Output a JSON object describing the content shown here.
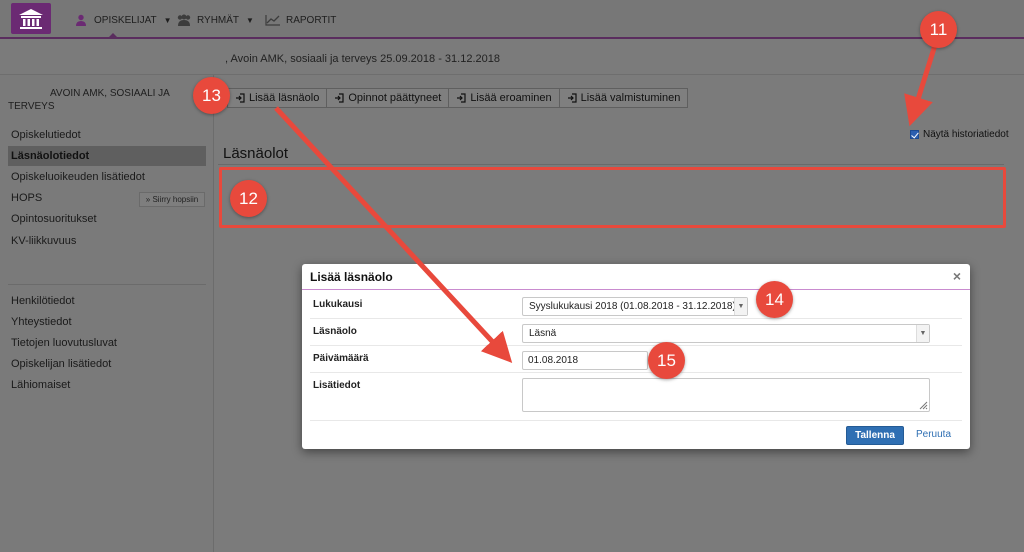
{
  "nav": {
    "items": [
      {
        "label": "OPISKELIJAT",
        "icon": "person-icon",
        "has_caret": true
      },
      {
        "label": "RYHMÄT",
        "icon": "group-icon",
        "has_caret": true
      },
      {
        "label": "RAPORTIT",
        "icon": "chart-line-icon",
        "has_caret": false
      }
    ],
    "logo_icon": "institution-icon"
  },
  "context": ", Avoin AMK, sosiaali ja terveys 25.09.2018 - 31.12.2018",
  "sidebar": {
    "title_line1": "AVOIN AMK, SOSIAALI JA",
    "title_line2": "TERVEYS",
    "items_top": [
      {
        "label": "Opiskelutiedot",
        "active": false
      },
      {
        "label": "Läsnäolotiedot",
        "active": true
      },
      {
        "label": "Opiskeluoikeuden lisätiedot",
        "active": false
      },
      {
        "label": "HOPS",
        "active": false
      },
      {
        "label": "Opintosuoritukset",
        "active": false
      },
      {
        "label": "KV-liikkuvuus",
        "active": false
      }
    ],
    "hops_button": "» Siirry hopsiin",
    "items_bottom": [
      {
        "label": "Henkilötiedot"
      },
      {
        "label": "Yhteystiedot"
      },
      {
        "label": "Tietojen luovutusluvat"
      },
      {
        "label": "Opiskelijan lisätiedot"
      },
      {
        "label": "Lähiomaiset"
      }
    ]
  },
  "toolbar": {
    "buttons": [
      "Lisää läsnäolo",
      "Opinnot päättyneet",
      "Lisää eroaminen",
      "Lisää valmistuminen"
    ]
  },
  "history": {
    "label": "Näytä historiatiedot",
    "checked": true
  },
  "section_title": "Läsnäolot",
  "modal": {
    "title": "Lisää läsnäolo",
    "close": "×",
    "fields": [
      {
        "label": "Lukukausi",
        "value": "Syyslukukausi 2018 (01.08.2018 - 31.12.2018)",
        "type": "select"
      },
      {
        "label": "Läsnäolo",
        "value": "Läsnä",
        "type": "select"
      },
      {
        "label": "Päivämäärä",
        "value": "01.08.2018",
        "type": "text"
      },
      {
        "label": "Lisätiedot",
        "value": "",
        "type": "textarea"
      }
    ],
    "save": "Tallenna",
    "cancel": "Peruuta"
  },
  "annotations": [
    "11",
    "12",
    "13",
    "14",
    "15"
  ],
  "colors": {
    "annotation": "#e8493c",
    "brand": "#6b2a73",
    "primary": "#2f6fb3"
  }
}
